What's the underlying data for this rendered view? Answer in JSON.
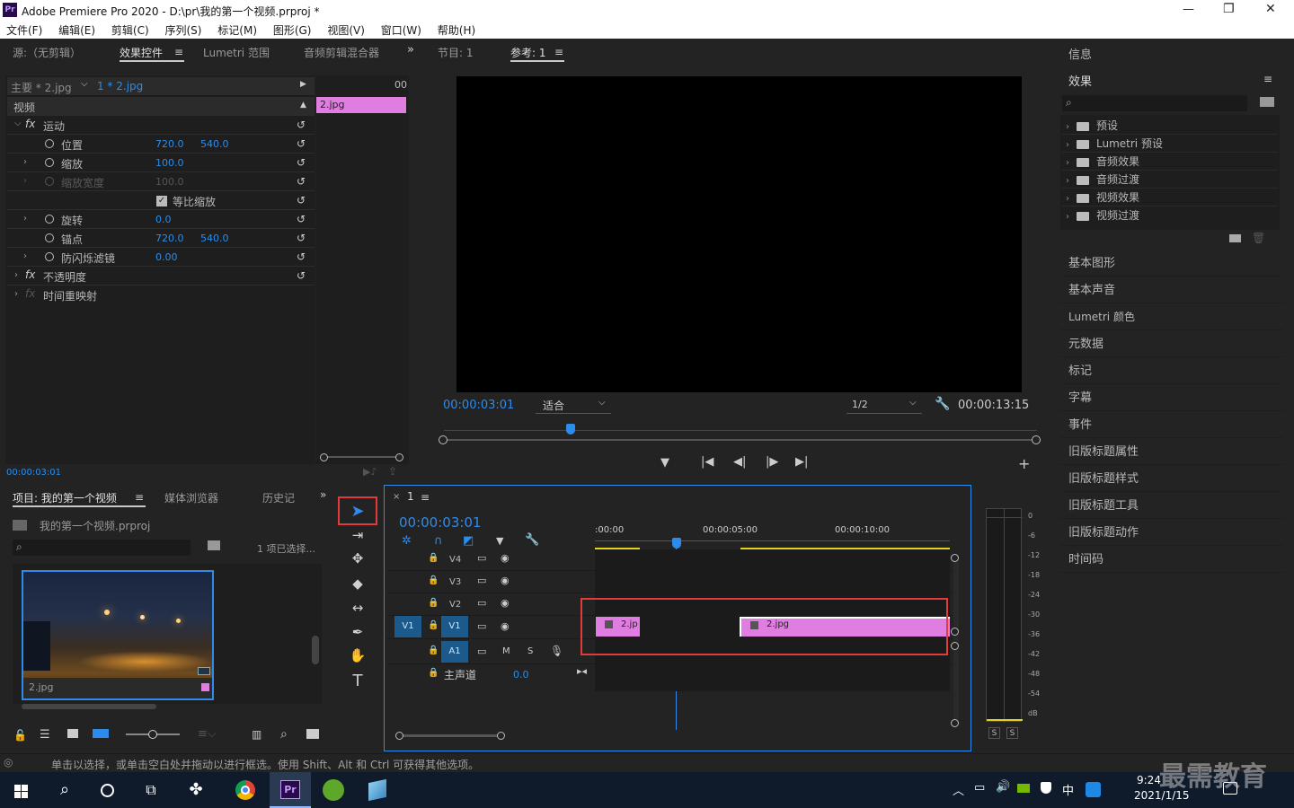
{
  "app": {
    "title": "Adobe Premiere Pro 2020 - D:\\pr\\我的第一个视频.prproj *",
    "icon_label": "Pr",
    "window_controls": [
      "—",
      "❐",
      "✕"
    ]
  },
  "menu": [
    "文件(F)",
    "编辑(E)",
    "剪辑(C)",
    "序列(S)",
    "标记(M)",
    "图形(G)",
    "视图(V)",
    "窗口(W)",
    "帮助(H)"
  ],
  "source_panel": {
    "tabs": [
      "源:（无剪辑）",
      "效果控件",
      "Lumetri 范围",
      "音频剪辑混合器"
    ],
    "master_clip": "主要 * 2.jpg",
    "sequence_clip": "1 * 2.jpg",
    "ruler_label": "00",
    "clip_name": "2.jpg",
    "video_header": "视频",
    "fx": "fx",
    "motion": "运动",
    "position": {
      "label": "位置",
      "x": "720.0",
      "y": "540.0"
    },
    "scale": {
      "label": "缩放",
      "value": "100.0"
    },
    "scale_width": {
      "label": "缩放宽度",
      "value": "100.0"
    },
    "uniform_scale": "等比缩放",
    "rotation": {
      "label": "旋转",
      "value": "0.0"
    },
    "anchor": {
      "label": "锚点",
      "x": "720.0",
      "y": "540.0"
    },
    "anti_flicker": {
      "label": "防闪烁滤镜",
      "value": "0.00"
    },
    "opacity": "不透明度",
    "time_remap": "时间重映射",
    "timecode": "00:00:03:01"
  },
  "program_panel": {
    "tabs": [
      "节目: 1",
      "参考: 1"
    ],
    "timecode": "00:00:03:01",
    "fit": "适合",
    "resolution": "1/2",
    "duration": "00:00:13:15"
  },
  "project_panel": {
    "tabs": [
      "项目: 我的第一个视频",
      "媒体浏览器",
      "历史记"
    ],
    "project_file": "我的第一个视频.prproj",
    "selection": "1 项已选择...",
    "thumb_name": "2.jpg"
  },
  "timeline": {
    "tab": "1",
    "timecode": "00:00:03:01",
    "ruler": [
      ":00:00",
      "00:00:05:00",
      "00:00:10:00"
    ],
    "tracks": [
      "V4",
      "V3",
      "V2",
      "V1"
    ],
    "v1_src": "V1",
    "a1": "A1",
    "mute": "M",
    "solo": "S",
    "master": "主声道",
    "master_value": "0.0",
    "clip1": "2.jp",
    "clip2": "2.jpg"
  },
  "meter": {
    "scale": [
      "0",
      "-6",
      "-12",
      "-18",
      "-24",
      "-30",
      "-36",
      "-42",
      "-48",
      "-54",
      "dB"
    ],
    "solo": [
      "S",
      "S"
    ]
  },
  "right_panel": {
    "info": "信息",
    "effects": "效果",
    "effects_tree": [
      "预设",
      "Lumetri 预设",
      "音频效果",
      "音频过渡",
      "视频效果",
      "视频过渡"
    ],
    "list": [
      "基本图形",
      "基本声音",
      "Lumetri 颜色",
      "元数据",
      "标记",
      "字幕",
      "事件",
      "旧版标题属性",
      "旧版标题样式",
      "旧版标题工具",
      "旧版标题动作",
      "时间码"
    ]
  },
  "status_bar": "单击以选择，或单击空白处并拖动以进行框选。使用 Shift、Alt 和 Ctrl 可获得其他选项。",
  "taskbar": {
    "time": "9:24",
    "date": "2021/1/15",
    "ime": "中",
    "watermark": "最需教育"
  },
  "colors": {
    "accent": "#2d8ceb",
    "clip": "#e07de0",
    "highlight": "#e23b3b",
    "bg": "#232323"
  }
}
